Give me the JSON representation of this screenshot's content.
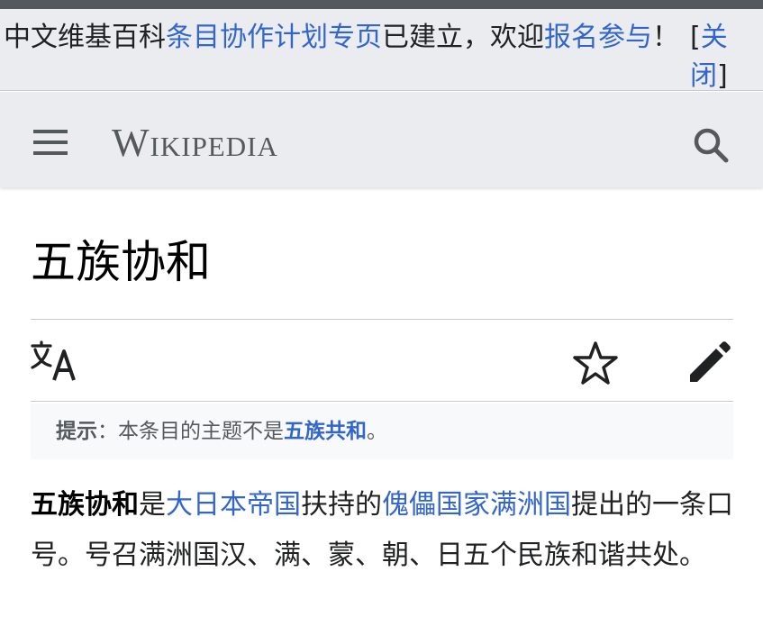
{
  "site_notice": {
    "t1": "中文维基百科",
    "link1": "条目协作计划专页",
    "t2": "已建立，欢迎",
    "link2": "报名参与",
    "t3": "！",
    "close_open": "[",
    "close_label": "关闭",
    "close_close": "]"
  },
  "header": {
    "wordmark": "Wikipedia",
    "menu_icon": "hamburger-menu-icon",
    "search_icon": "search-icon"
  },
  "page": {
    "title": "五族协和",
    "actions": {
      "language_icon": "language-icon",
      "watch_icon": "star-icon",
      "edit_icon": "pencil-icon"
    },
    "hatnote": {
      "label": "提示",
      "sep": "：",
      "text": "本条目的主题不是",
      "link": "五族共和",
      "end": "。"
    },
    "lead": {
      "bold": "五族协和",
      "t1": "是",
      "link1": "大日本帝国",
      "t2": "扶持的",
      "link2": "傀儡国家",
      "link3": "满洲国",
      "t3": "提出的一条口号。号召满洲国汉、满、蒙、朝、日五个民族和谐共处。"
    }
  },
  "colors": {
    "link": "#3366cc",
    "header_bg": "#eaecf0",
    "icon": "#54595d",
    "hatnote_bg": "#f8f9fa"
  }
}
